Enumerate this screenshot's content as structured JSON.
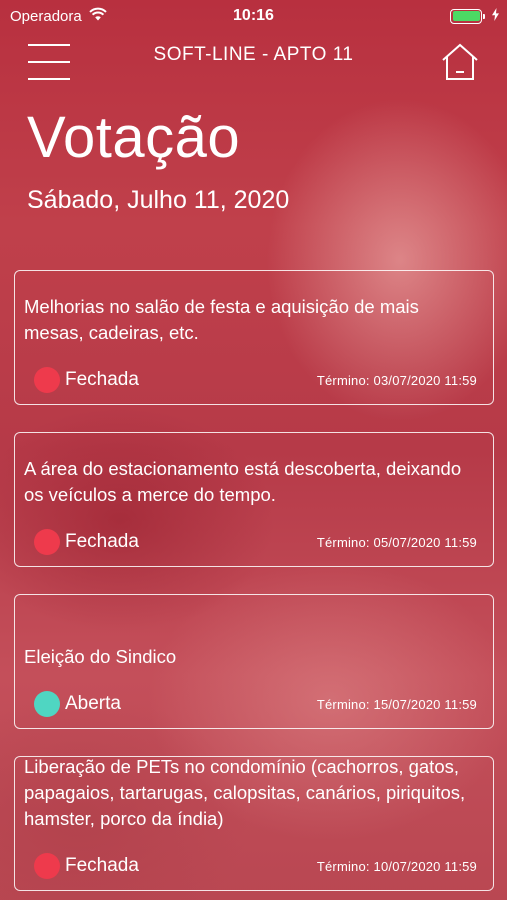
{
  "status_bar": {
    "carrier": "Operadora",
    "time": "10:16",
    "battery_level": 1.0,
    "battery_color": "#4cd964"
  },
  "nav": {
    "title": "SOFT-LINE - APTO 11",
    "menu_icon": "hamburger-menu-icon",
    "home_icon": "home-icon"
  },
  "header": {
    "title": "Votação",
    "date": "Sábado, Julho 11, 2020"
  },
  "colors": {
    "closed": "#ee3a4c",
    "open": "#4fd6c2"
  },
  "votes": [
    {
      "description": "Melhorias no salão de festa e aquisição de mais mesas, cadeiras, etc.",
      "status": "Fechada",
      "status_color": "#ee3a4c",
      "deadline": "Término: 03/07/2020 11:59"
    },
    {
      "description": "A área do estacionamento está descoberta, deixando os veículos a merce do tempo.",
      "status": "Fechada",
      "status_color": "#ee3a4c",
      "deadline": "Término: 05/07/2020 11:59"
    },
    {
      "description": "Eleição do Sindico",
      "status": "Aberta",
      "status_color": "#4fd6c2",
      "deadline": "Término:  15/07/2020 11:59"
    },
    {
      "description": "Liberação de PETs no condomínio (cachorros, gatos, papagaios, tartarugas, calopsitas, canários, piriquitos, hamster, porco da índia)",
      "status": "Fechada",
      "status_color": "#ee3a4c",
      "deadline": "Término:  10/07/2020 11:59"
    }
  ]
}
